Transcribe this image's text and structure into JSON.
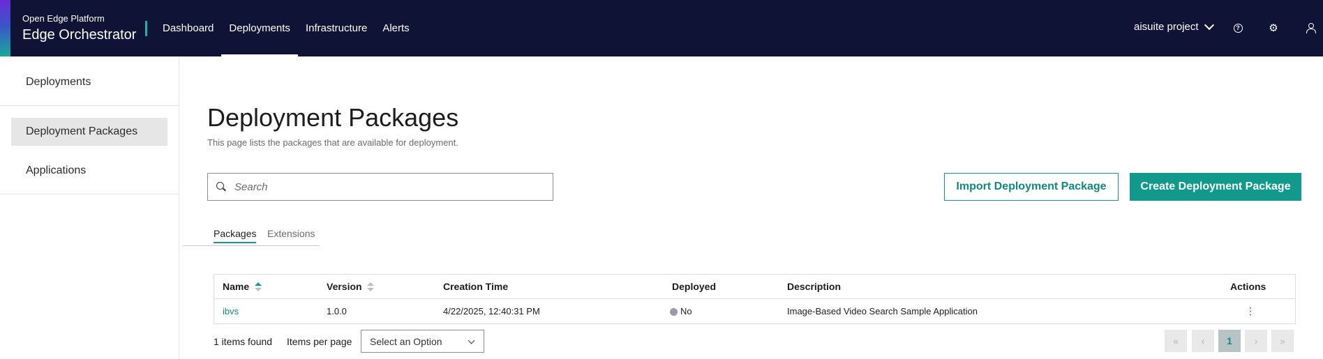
{
  "header": {
    "brand_small": "Open Edge Platform",
    "brand_large": "Edge Orchestrator",
    "nav": [
      "Dashboard",
      "Deployments",
      "Infrastructure",
      "Alerts"
    ],
    "active_nav": "Deployments",
    "project": "aisuite project",
    "icons": [
      "chevron-down-icon",
      "help-icon",
      "gear-icon",
      "user-icon"
    ]
  },
  "sidebar": {
    "items": [
      {
        "label": "Deployments"
      },
      {
        "label": "Deployment Packages",
        "active": true
      },
      {
        "label": "Applications"
      }
    ]
  },
  "main": {
    "title": "Deployment Packages",
    "subtitle": "This page lists the packages that are available for deployment.",
    "search_placeholder": "Search",
    "import_label": "Import Deployment Package",
    "create_label": "Create Deployment Package",
    "tabs": [
      "Packages",
      "Extensions"
    ],
    "active_tab": "Packages"
  },
  "table": {
    "columns": [
      "Name",
      "Version",
      "Creation Time",
      "Deployed",
      "Description",
      "Actions"
    ],
    "rows": [
      {
        "name": "ibvs",
        "version": "1.0.0",
        "created": "4/22/2025, 12:40:31 PM",
        "deployed": "No",
        "description": "Image-Based Video Search Sample Application",
        "actions_icon": "⋮"
      }
    ]
  },
  "footer": {
    "count": "1 items found",
    "items_per_page": "Items per page",
    "select_value": "Select an Option",
    "current_page": "1",
    "pager_icons": [
      "«",
      "‹",
      "›",
      "»"
    ]
  },
  "colors": {
    "header_bg": "#0f1437",
    "accent": "#11998b",
    "sidebar_active": "#e6e6e6"
  }
}
